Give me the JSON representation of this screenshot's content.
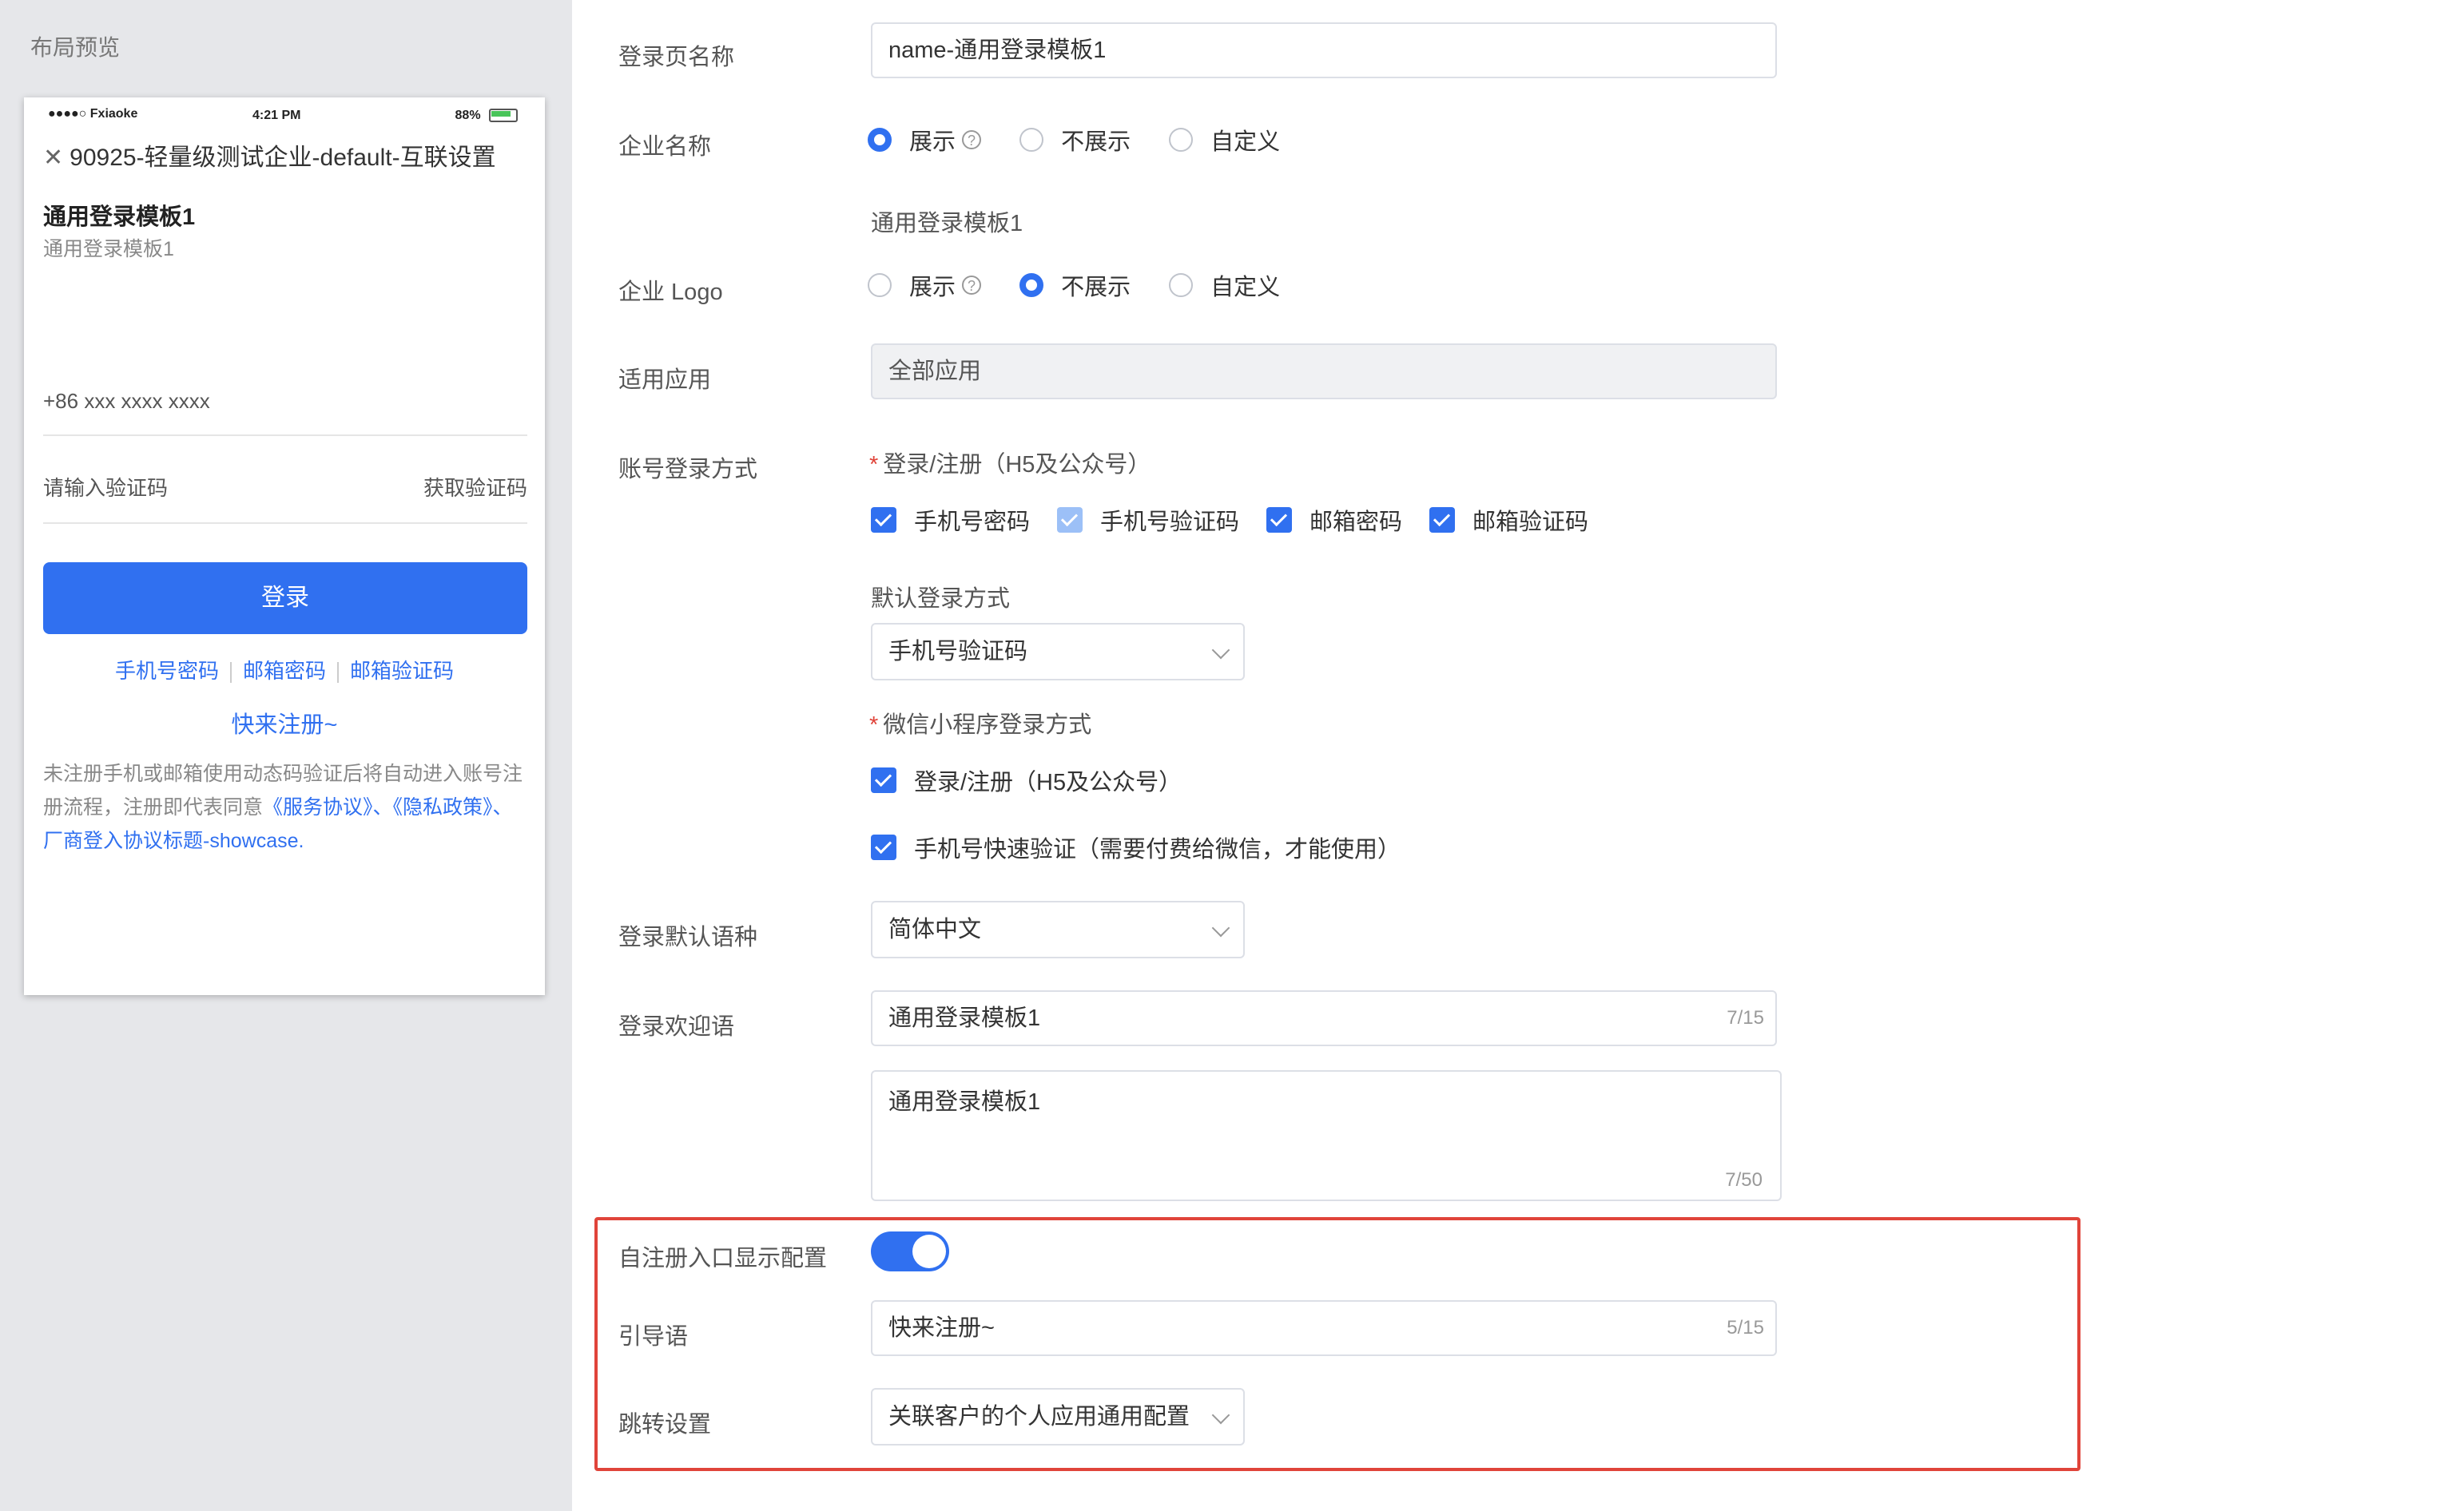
{
  "preview": {
    "title": "布局预览",
    "status": {
      "carrier": "●●●●○ Fxiaoke",
      "time": "4:21 PM",
      "battery": "88%"
    },
    "header_close": "✕",
    "header_title": "90925-轻量级测试企业-default-互联设置",
    "template_title": "通用登录模板1",
    "template_sub": "通用登录模板1",
    "phone_placeholder": "+86 xxx xxxx xxxx",
    "code_placeholder": "请输入验证码",
    "get_code": "获取验证码",
    "login_button": "登录",
    "alt_links": [
      "手机号密码",
      "邮箱密码",
      "邮箱验证码"
    ],
    "quick_register": "快来注册~",
    "agreement_text": "未注册手机或邮箱使用动态码验证后将自动进入账号注册流程，注册即代表同意",
    "agreement_link1": "《服务协议》、《隐私政策》、厂商登入协议标题-showcase."
  },
  "form": {
    "page_name": {
      "label": "登录页名称",
      "value": "name-通用登录模板1"
    },
    "company_name": {
      "label": "企业名称",
      "options": [
        "展示",
        "不展示",
        "自定义"
      ],
      "selected": "展示",
      "preview_text": "通用登录模板1"
    },
    "company_logo": {
      "label": "企业 Logo",
      "options": [
        "展示",
        "不展示",
        "自定义"
      ],
      "selected": "不展示"
    },
    "apps": {
      "label": "适用应用",
      "value": "全部应用"
    },
    "login_method": {
      "label": "账号登录方式",
      "sub_label": "登录/注册（H5及公众号）",
      "checks": [
        "手机号密码",
        "手机号验证码",
        "邮箱密码",
        "邮箱验证码"
      ],
      "default_label": "默认登录方式",
      "default_value": "手机号验证码",
      "mini_label": "微信小程序登录方式",
      "mini_checks": [
        "登录/注册（H5及公众号）",
        "手机号快速验证（需要付费给微信，才能使用）"
      ]
    },
    "language": {
      "label": "登录默认语种",
      "value": "简体中文"
    },
    "welcome": {
      "label": "登录欢迎语",
      "value": "通用登录模板1",
      "counter": "7/15",
      "textarea_value": "通用登录模板1",
      "textarea_counter": "7/50"
    },
    "self_register": {
      "label": "自注册入口显示配置",
      "enabled": true
    },
    "guide": {
      "label": "引导语",
      "value": "快来注册~",
      "counter": "5/15"
    },
    "redirect": {
      "label": "跳转设置",
      "value": "关联客户的个人应用通用配置"
    }
  },
  "colors": {
    "primary": "#3070f0",
    "highlight": "#e0443a"
  }
}
